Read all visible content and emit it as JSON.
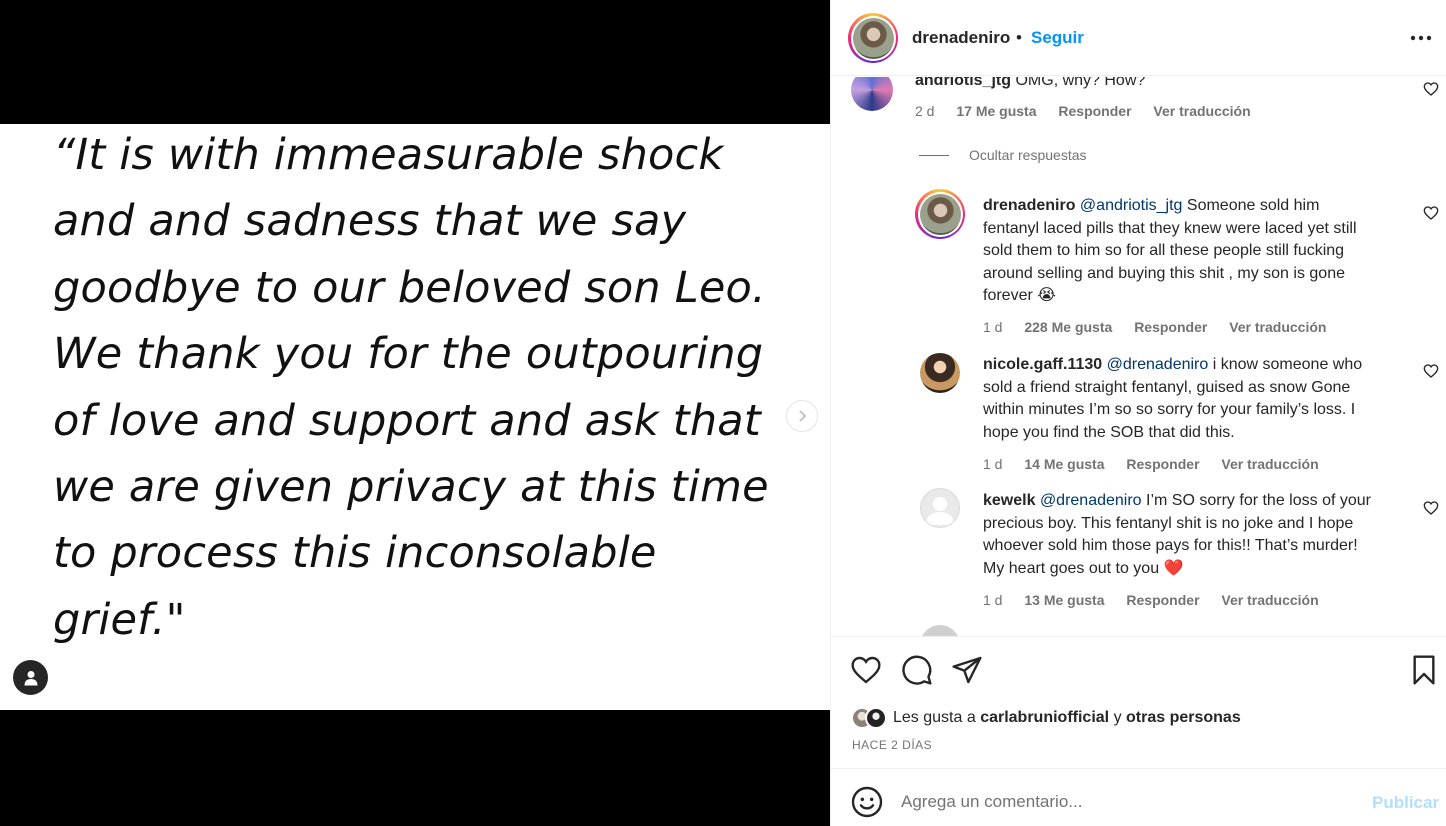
{
  "post": {
    "quote_lines": [
      "“It is with immeasurable shock",
      "and and sadness that we say",
      "goodbye to our beloved son Leo.",
      "We thank you for the outpouring",
      "of love and support and ask that",
      "we are given privacy at this time",
      "to process this inconsolable",
      "grief.\""
    ]
  },
  "header": {
    "username": "drenadeniro",
    "separator": "•",
    "follow_label": "Seguir"
  },
  "comments": {
    "top": {
      "username": "andriotis_jtg",
      "text": "OMG, why? How?",
      "time": "2 d",
      "likes": "17 Me gusta",
      "reply": "Responder",
      "translate": "Ver traducción"
    },
    "hide_replies": "Ocultar respuestas",
    "replies": [
      {
        "username": "drenadeniro",
        "mention": "@andriotis_jtg",
        "lines": [
          "Someone sold him",
          "fentanyl laced pills that they knew were laced yet still",
          "sold them to him so for all these people still fucking",
          "around selling and buying this shit , my son is gone",
          "forever"
        ],
        "emoji": "😭",
        "time": "1 d",
        "likes": "228 Me gusta",
        "reply": "Responder",
        "translate": "Ver traducción"
      },
      {
        "username": "nicole.gaff.1130",
        "mention": "@drenadeniro",
        "lines": [
          "i know someone who",
          "sold a friend straight fentanyl, guised as snow Gone",
          "within minutes I’m so so sorry for your family’s loss. I",
          "hope you find the SOB that did this."
        ],
        "time": "1 d",
        "likes": "14 Me gusta",
        "reply": "Responder",
        "translate": "Ver traducción"
      },
      {
        "username": "kewelk",
        "mention": "@drenadeniro",
        "lines": [
          "I’m SO sorry for the loss of your",
          "precious boy. This fentanyl shit is no joke and I hope",
          "whoever sold him those pays for this!! That’s murder!",
          "My heart goes out to you"
        ],
        "emoji": "❤️",
        "time": "1 d",
        "likes": "13 Me gusta",
        "reply": "Responder",
        "translate": "Ver traducción"
      }
    ]
  },
  "likes": {
    "prefix": "Les gusta a",
    "user": "carlabruniofficial",
    "connector": "y",
    "others": "otras personas"
  },
  "timestamp": "HACE 2 DÍAS",
  "composer": {
    "placeholder": "Agrega un comentario...",
    "publish_label": "Publicar"
  },
  "colors": {
    "link_blue": "#0095f6",
    "mention_blue": "#00376b",
    "publish_disabled": "#b2dffc",
    "meta_gray": "#737373"
  }
}
